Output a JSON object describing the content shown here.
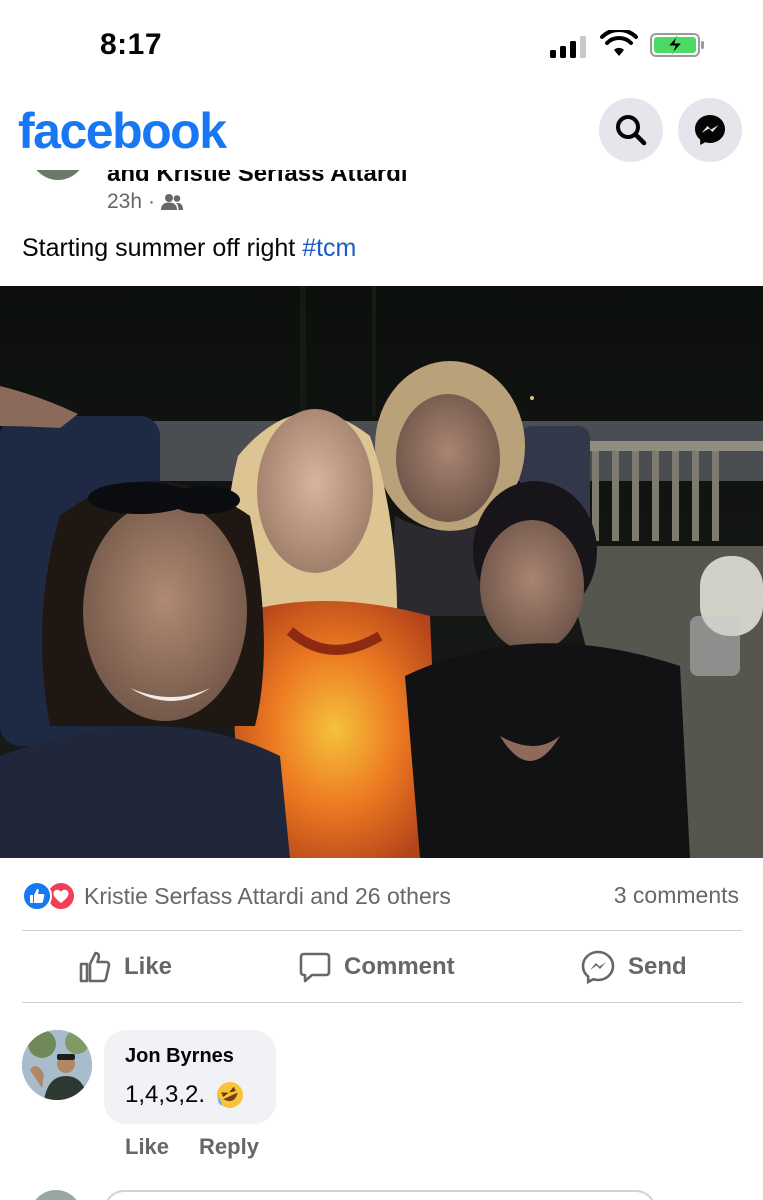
{
  "status_bar": {
    "time": "8:17"
  },
  "header": {
    "logo": "facebook",
    "search_icon": "search-icon",
    "messenger_icon": "messenger-icon"
  },
  "post": {
    "author_cut": "and Kristie Serfass Attardi",
    "time": "23h",
    "separator": "·",
    "audience_icon": "friends-icon",
    "text": "Starting summer off right ",
    "hashtag": "#tcm",
    "reactions_text": "Kristie Serfass Attardi and 26 others",
    "comments_count": "3 comments",
    "actions": {
      "like": "Like",
      "comment": "Comment",
      "send": "Send"
    }
  },
  "comment": {
    "author": "Jon Byrnes",
    "text": "1,4,3,2.",
    "emoji": "🤣",
    "like": "Like",
    "reply": "Reply"
  },
  "colors": {
    "brand": "#1877f2",
    "hashtag": "#1d5bc7",
    "secondary_text": "#65676b",
    "love": "#f33e58",
    "bubble": "#f0f2f5"
  }
}
